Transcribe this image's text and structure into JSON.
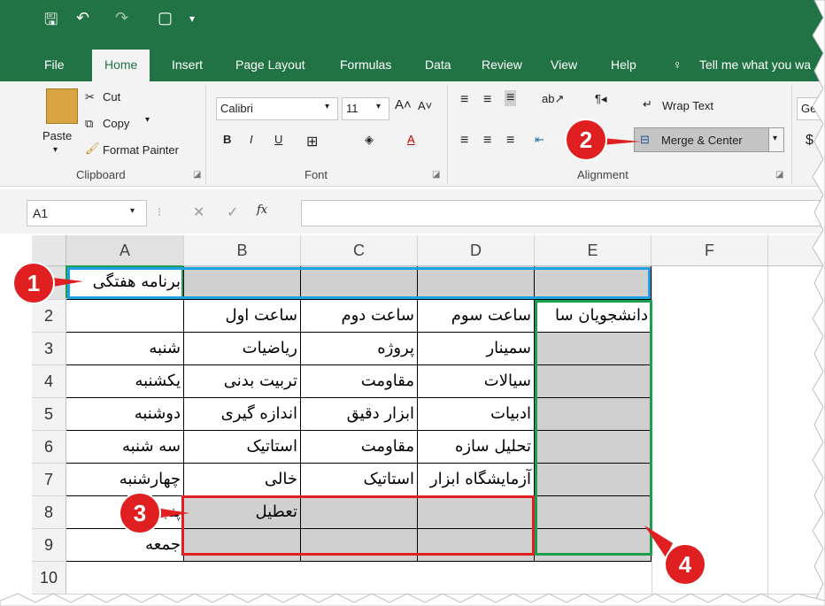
{
  "qat": {
    "save": "🖫",
    "undo": "↶",
    "redo": "↷",
    "new": "▢",
    "more": "⚌"
  },
  "tabs": [
    "File",
    "Home",
    "Insert",
    "Page Layout",
    "Formulas",
    "Data",
    "Review",
    "View",
    "Help"
  ],
  "tell_me": "Tell me what you wa",
  "clipboard": {
    "paste": "Paste",
    "cut": "Cut",
    "copy": "Copy",
    "format_painter": "Format Painter",
    "label": "Clipboard"
  },
  "font": {
    "name": "Calibri",
    "size": "11",
    "bold": "B",
    "italic": "I",
    "underline": "U",
    "label": "Font"
  },
  "alignment": {
    "wrap": "Wrap Text",
    "merge": "Merge & Center",
    "label": "Alignment"
  },
  "number_partial": {
    "general": "Ge",
    "currency": "$"
  },
  "formula_bar": {
    "name_box": "A1",
    "fx": "fx",
    "value": ""
  },
  "columns": [
    "A",
    "B",
    "C",
    "D",
    "E",
    "F"
  ],
  "rows": [
    "1",
    "2",
    "3",
    "4",
    "5",
    "6",
    "7",
    "8",
    "9",
    "10"
  ],
  "cells": {
    "A1": "برنامه هفتگی",
    "B2": "ساعت اول",
    "C2": "ساعت دوم",
    "D2": "ساعت سوم",
    "E2": "دانشجویان سا",
    "A3": "شنبه",
    "B3": "ریاضیات",
    "C3": "پروژه",
    "D3": "سمینار",
    "A4": "یکشنبه",
    "B4": "تربیت بدنی",
    "C4": "مقاومت",
    "D4": "سیالات",
    "A5": "دوشنبه",
    "B5": "اندازه گیری",
    "C5": "ابزار دقیق",
    "D5": "ادبیات",
    "A6": "سه شنبه",
    "B6": "استاتیک",
    "C6": "مقاومت",
    "D6": "تحلیل سازه",
    "A7": "چهارشنبه",
    "B7": "خالی",
    "C7": "استاتیک",
    "D7": "آزمایشگاه ابزار",
    "A8": "پنجشنبه",
    "B8": "تعطیل",
    "A9": "جمعه"
  },
  "badges": [
    "1",
    "2",
    "3",
    "4"
  ],
  "colors": {
    "excel_green": "#217346",
    "selection_gray": "#d0d0d0",
    "badge_red": "#e02020",
    "outline_blue": "#1ea1e0",
    "outline_red": "#e02020",
    "outline_green": "#1e9e50"
  }
}
